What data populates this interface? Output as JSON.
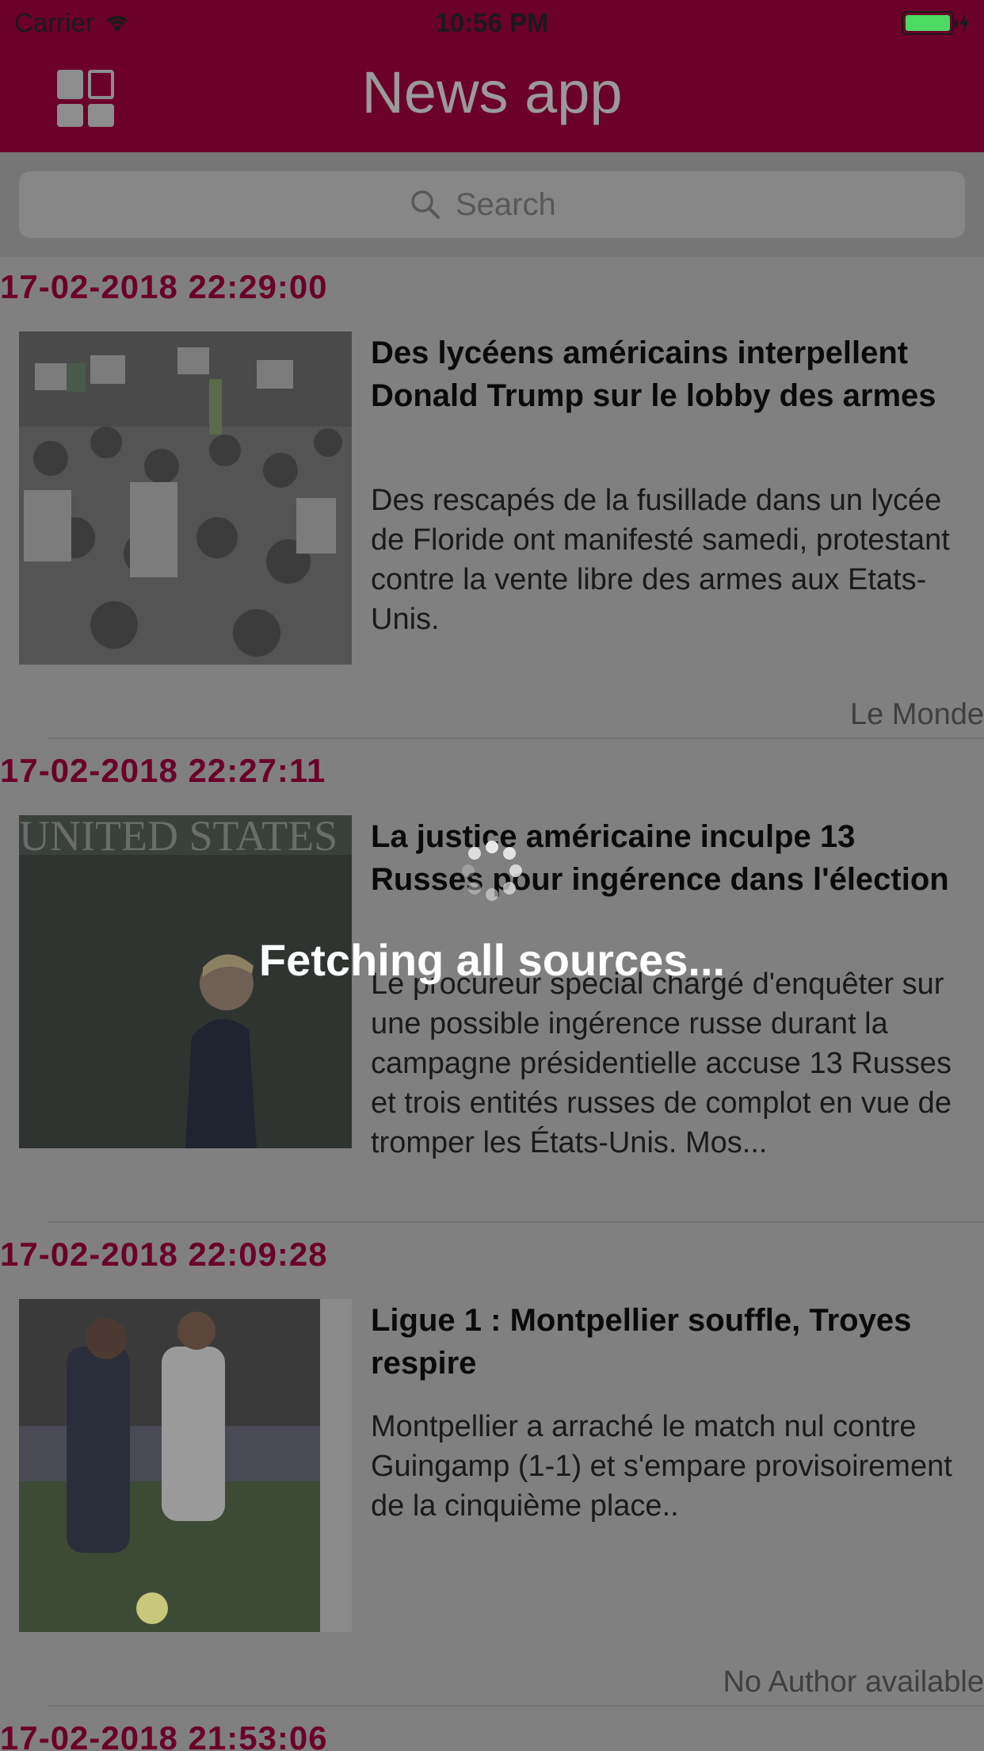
{
  "status_bar": {
    "carrier": "Carrier",
    "time": "10:56 PM"
  },
  "nav": {
    "title": "News app",
    "menu_icon": "grid-icon"
  },
  "search": {
    "placeholder": "Search",
    "icon": "search-icon"
  },
  "colors": {
    "brand": "#6b0029",
    "overlay": "#808080",
    "date": "#6b0029",
    "battery": "#4cd964"
  },
  "articles": [
    {
      "date": "17-02-2018 22:29:00",
      "title": "Des lycéens américains interpellent Donald Trump sur le lobby des armes",
      "description": "Des rescapés de la fusillade dans un lycée de Floride ont manifesté samedi, protestant contre la vente libre des armes aux Etats-Unis.",
      "source": "Le Monde"
    },
    {
      "date": "17-02-2018 22:27:11",
      "title": "La justice américaine inculpe 13 Russes pour ingérence dans l'élection",
      "description": "Le procureur spécial chargé d'enquêter sur une possible ingérence russe durant la campagne présidentielle accuse 13 Russes et trois entités russes de complot en vue de tromper les États-Unis. Mos...",
      "source": ""
    },
    {
      "date": "17-02-2018 22:09:28",
      "title": "Ligue 1 : Montpellier souffle, Troyes respire",
      "description": "Montpellier a arraché le match nul contre Guingamp (1-1) et s'empare provisoirement de la cinquième place..",
      "source": "No Author available"
    },
    {
      "date": "17-02-2018 21:53:06"
    }
  ],
  "loading": {
    "text": "Fetching all sources..."
  }
}
